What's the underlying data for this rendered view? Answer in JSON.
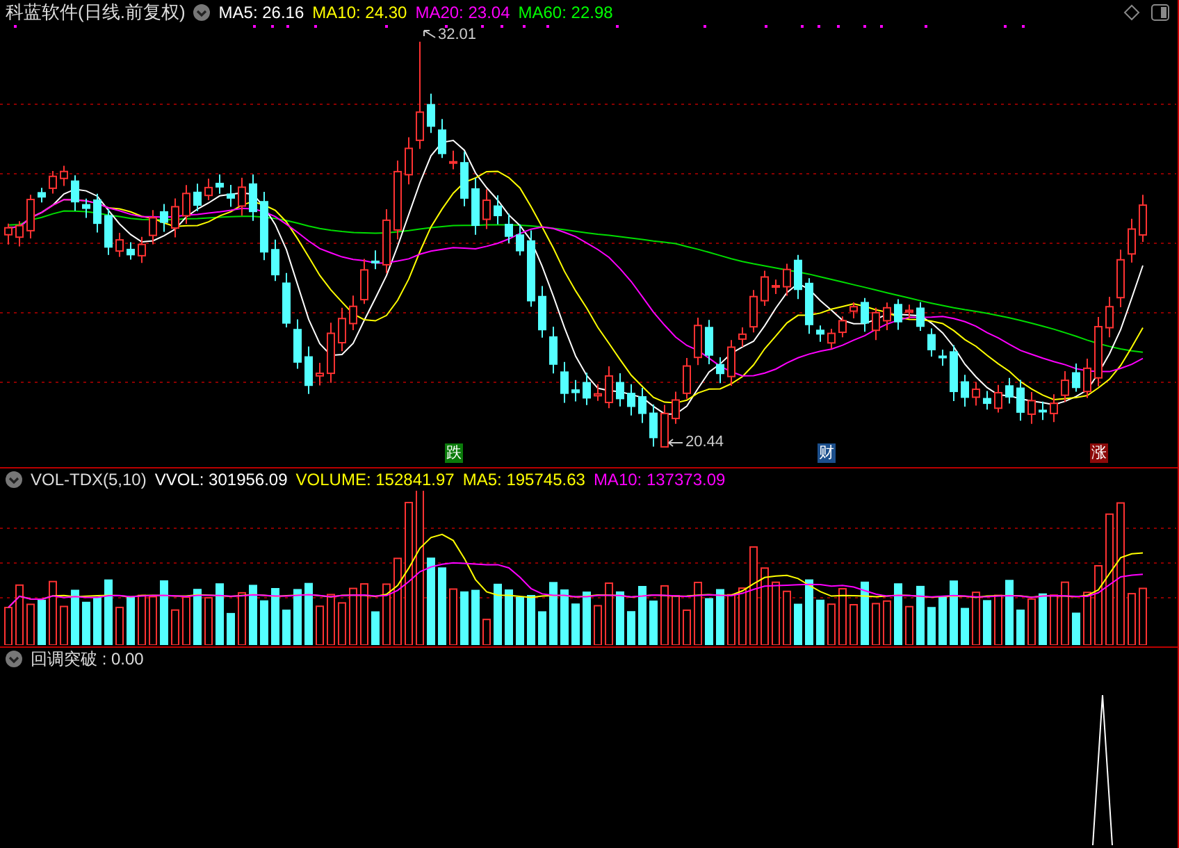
{
  "main_panel": {
    "title": "科蓝软件(日线.前复权)",
    "indicators": [
      {
        "label": "MA5: 26.16",
        "color": "#ffffff"
      },
      {
        "label": "MA10: 24.30",
        "color": "#ffff00"
      },
      {
        "label": "MA20: 23.04",
        "color": "#ff00ff"
      },
      {
        "label": "MA60: 22.98",
        "color": "#00ff00"
      }
    ],
    "high_label": "32.01",
    "low_label": "20.44",
    "events": [
      {
        "text": "跌",
        "color": "#0a7a0a"
      },
      {
        "text": "财",
        "color": "#1c4f8c"
      },
      {
        "text": "涨",
        "color": "#8c0a0a"
      }
    ]
  },
  "volume_panel": {
    "title": "VOL-TDX(5,10)",
    "indicators": [
      {
        "label": "VVOL: 301956.09",
        "color": "#ffffff"
      },
      {
        "label": "VOLUME: 152841.97",
        "color": "#ffff00"
      },
      {
        "label": "MA5: 195745.63",
        "color": "#ffff00"
      },
      {
        "label": "MA10: 137373.09",
        "color": "#ff00ff"
      }
    ]
  },
  "signal_panel": {
    "label": "回调突破 : 0.00"
  }
}
